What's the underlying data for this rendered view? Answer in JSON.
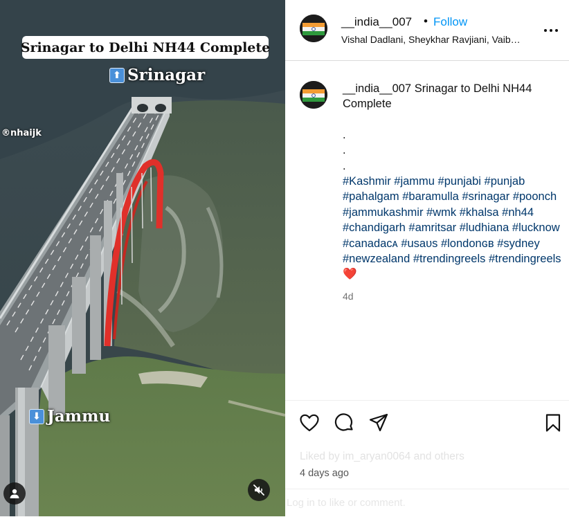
{
  "media": {
    "title_banner": "Srinagar to Delhi NH44 Complete",
    "top_label": "Srinagar",
    "bottom_label": "Jammu",
    "watermark": "®nhaijk",
    "arrow_up": "⬆",
    "arrow_down": "⬇",
    "icons": [
      "user-tag-icon",
      "mute-icon"
    ]
  },
  "header": {
    "username": "__india__007",
    "dot": "•",
    "follow_label": "Follow",
    "subtitle": "Vishal Dadlani, Sheykhar Ravjiani, Vaib…",
    "more_icon": "more-horizontal-icon"
  },
  "caption": {
    "username": "__india__007",
    "text": "Srinagar to Delhi NH44 Complete",
    "dots": [
      ".",
      ".",
      "."
    ],
    "hashtags": "#Kashmir #jammu #punjabi #punjab #pahalgam #baramulla #srinagar #poonch #jammukashmir #wmk #khalsa #nh44 #chandigarh #amritsar #ludhiana #lucknow #canadaᴄᴀ #usaᴜs #londonɢʙ #sydney #newzealand #trendingreels #trendingreels",
    "heart_emoji": "❤️",
    "time": "4d"
  },
  "actions": {
    "icons": [
      "heart-icon",
      "comment-icon",
      "share-icon",
      "bookmark-icon"
    ],
    "liked_by": "Liked by im_aryan0064 and others",
    "time_ago": "4 days ago",
    "login_prompt": "Log in to like or comment."
  },
  "colors": {
    "follow": "#0095f6",
    "hashtag": "#00376b",
    "bridge_arch": "#e0302a",
    "heart": "#e0245e"
  }
}
